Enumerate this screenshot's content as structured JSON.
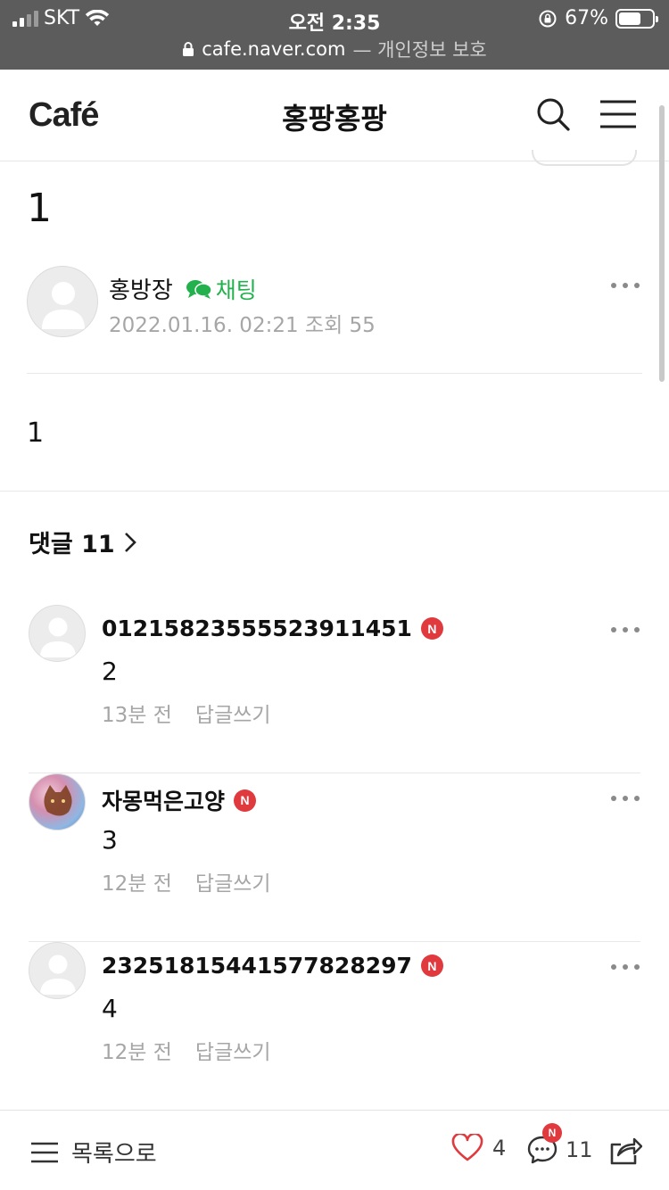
{
  "status_bar": {
    "carrier": "SKT",
    "time": "오전 2:35",
    "battery": "67%",
    "battery_level": 0.67
  },
  "url_bar": {
    "domain": "cafe.naver.com",
    "suffix": "— 개인정보 보호"
  },
  "header": {
    "logo": "Café",
    "title": "홍팡홍팡",
    "icons": [
      "search-icon",
      "hamburger-menu-icon"
    ]
  },
  "post": {
    "title": "1",
    "author": "홍방장",
    "chat_label": "채팅",
    "meta": "2022.01.16. 02:21  조회 55",
    "body": "1"
  },
  "comments_header": {
    "label": "댓글 11"
  },
  "comments": [
    {
      "name": "01215823555523911451",
      "badge": "N",
      "text": "2",
      "time": "13분 전",
      "reply": "답글쓰기",
      "avatar": "default"
    },
    {
      "name": "자몽먹은고양",
      "badge": "N",
      "text": "3",
      "time": "12분 전",
      "reply": "답글쓰기",
      "avatar": "photo"
    },
    {
      "name": "23251815441577828297",
      "badge": "N",
      "text": "4",
      "time": "12분 전",
      "reply": "답글쓰기",
      "avatar": "default"
    }
  ],
  "bottom_bar": {
    "list_label": "목록으로",
    "like_count": "4",
    "comment_badge": "N",
    "comment_count": "11"
  },
  "colors": {
    "accent_green": "#22b14c",
    "badge_red": "#e0393e",
    "like_red": "#e0393e"
  }
}
